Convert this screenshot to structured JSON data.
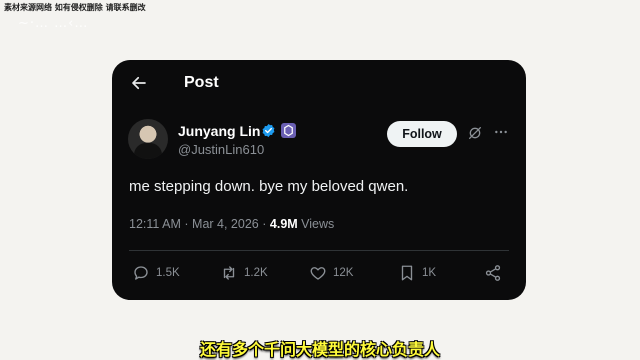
{
  "overlay": {
    "watermark": "素材来源网络 如有侵权删除 请联系删改",
    "faint_logo": "~·…  …‹…",
    "subtitle": "还有多个千问大模型的核心负责人"
  },
  "post": {
    "header_title": "Post",
    "author": {
      "display_name": "Junyang Lin",
      "handle": "@JustinLin610",
      "verified": true
    },
    "follow_label": "Follow",
    "text": "me stepping down. bye my beloved qwen.",
    "time": "12:11 AM",
    "separator": "·",
    "date": "Mar 4, 2026",
    "views_count": "4.9M",
    "views_label": "Views",
    "actions": {
      "replies": "1.5K",
      "reposts": "1.2K",
      "likes": "12K",
      "bookmarks": "1K"
    }
  },
  "colors": {
    "card_bg": "#0b0b0c",
    "verified_blue": "#1d9bf0",
    "subtitle_yellow": "#fffb3a"
  }
}
